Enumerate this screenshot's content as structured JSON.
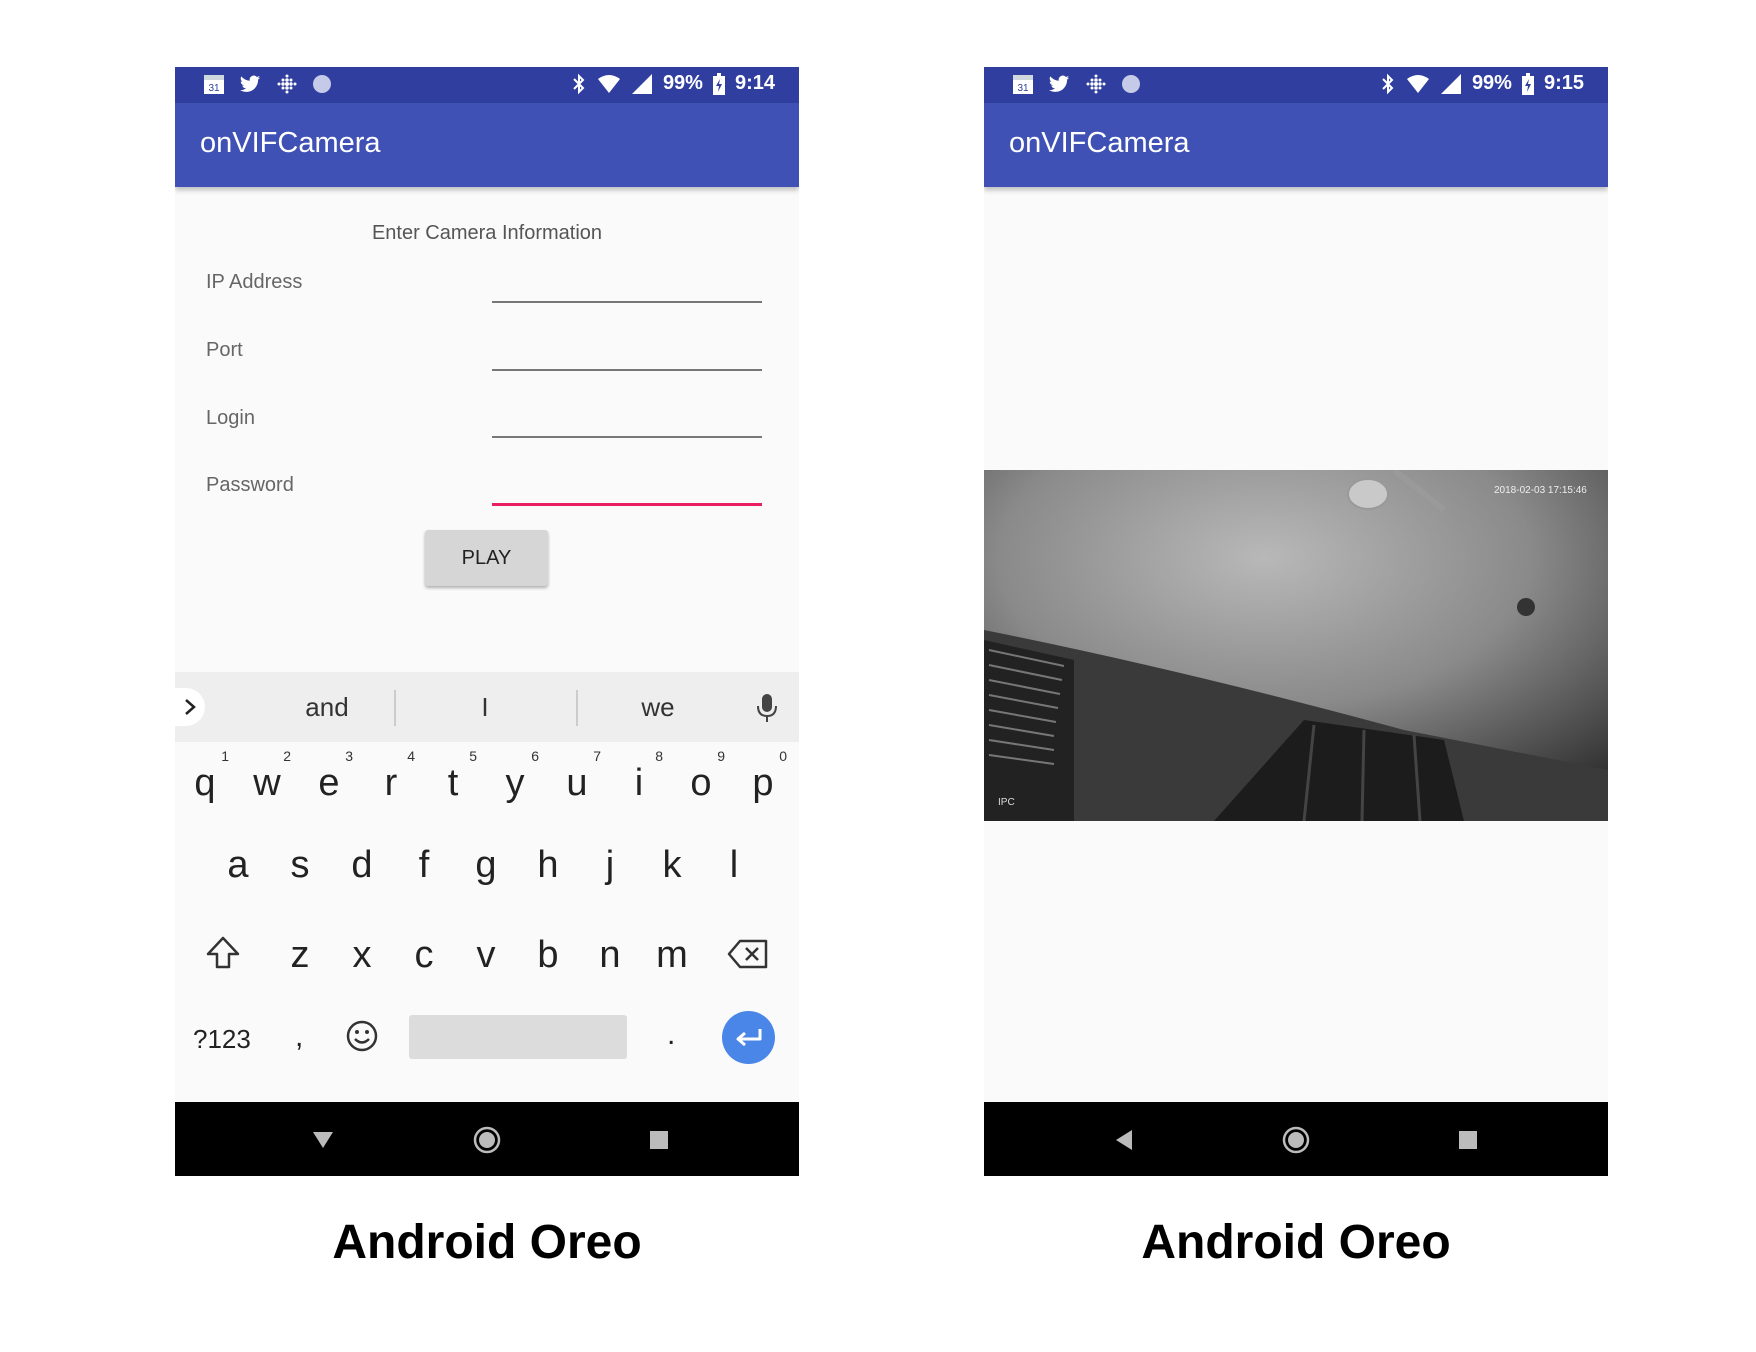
{
  "status_left_icons": [
    "calendar-icon",
    "twitter-icon",
    "fitbit-icon",
    "circle-icon"
  ],
  "phone1": {
    "status": {
      "calendar_day": "31",
      "battery": "99%",
      "time": "9:14"
    },
    "app_title": "onVIFCamera",
    "form": {
      "heading": "Enter Camera Information",
      "fields": [
        {
          "label": "IP Address",
          "value": ""
        },
        {
          "label": "Port",
          "value": ""
        },
        {
          "label": "Login",
          "value": ""
        },
        {
          "label": "Password",
          "value": ""
        }
      ],
      "play_label": "PLAY"
    },
    "keyboard": {
      "suggestions": [
        "and",
        "I",
        "we"
      ],
      "row1": [
        [
          "q",
          "1"
        ],
        [
          "w",
          "2"
        ],
        [
          "e",
          "3"
        ],
        [
          "r",
          "4"
        ],
        [
          "t",
          "5"
        ],
        [
          "y",
          "6"
        ],
        [
          "u",
          "7"
        ],
        [
          "i",
          "8"
        ],
        [
          "o",
          "9"
        ],
        [
          "p",
          "0"
        ]
      ],
      "row2": [
        "a",
        "s",
        "d",
        "f",
        "g",
        "h",
        "j",
        "k",
        "l"
      ],
      "row3": [
        "z",
        "x",
        "c",
        "v",
        "b",
        "n",
        "m"
      ],
      "symbols_label": "?123",
      "comma": ",",
      "period": "."
    }
  },
  "phone2": {
    "status": {
      "calendar_day": "31",
      "battery": "99%",
      "time": "9:15"
    },
    "app_title": "onVIFCamera",
    "video": {
      "timestamp": "2018-02-03 17:15:46",
      "watermark": "IPC"
    }
  },
  "captions": [
    "Android Oreo",
    "Android Oreo"
  ],
  "colors": {
    "status_bar": "#303f9f",
    "app_bar": "#3f51b5",
    "accent": "#e91e63",
    "enter_key": "#4a86e8"
  }
}
